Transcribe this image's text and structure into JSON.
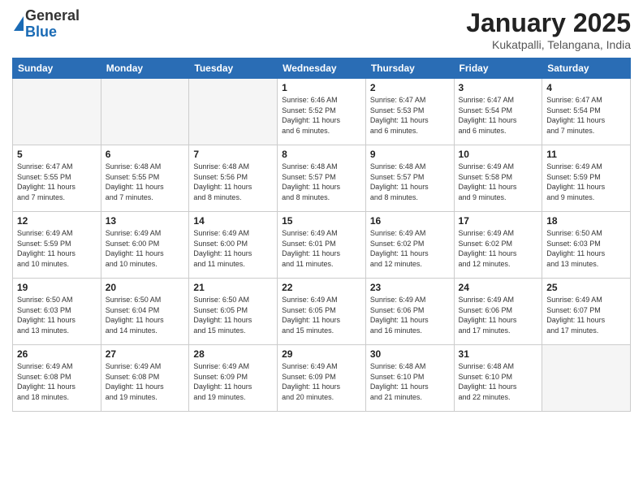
{
  "logo": {
    "line1": "General",
    "line2": "Blue"
  },
  "title": "January 2025",
  "subtitle": "Kukatpalli, Telangana, India",
  "headers": [
    "Sunday",
    "Monday",
    "Tuesday",
    "Wednesday",
    "Thursday",
    "Friday",
    "Saturday"
  ],
  "weeks": [
    [
      {
        "day": "",
        "info": ""
      },
      {
        "day": "",
        "info": ""
      },
      {
        "day": "",
        "info": ""
      },
      {
        "day": "1",
        "info": "Sunrise: 6:46 AM\nSunset: 5:52 PM\nDaylight: 11 hours\nand 6 minutes."
      },
      {
        "day": "2",
        "info": "Sunrise: 6:47 AM\nSunset: 5:53 PM\nDaylight: 11 hours\nand 6 minutes."
      },
      {
        "day": "3",
        "info": "Sunrise: 6:47 AM\nSunset: 5:54 PM\nDaylight: 11 hours\nand 6 minutes."
      },
      {
        "day": "4",
        "info": "Sunrise: 6:47 AM\nSunset: 5:54 PM\nDaylight: 11 hours\nand 7 minutes."
      }
    ],
    [
      {
        "day": "5",
        "info": "Sunrise: 6:47 AM\nSunset: 5:55 PM\nDaylight: 11 hours\nand 7 minutes."
      },
      {
        "day": "6",
        "info": "Sunrise: 6:48 AM\nSunset: 5:55 PM\nDaylight: 11 hours\nand 7 minutes."
      },
      {
        "day": "7",
        "info": "Sunrise: 6:48 AM\nSunset: 5:56 PM\nDaylight: 11 hours\nand 8 minutes."
      },
      {
        "day": "8",
        "info": "Sunrise: 6:48 AM\nSunset: 5:57 PM\nDaylight: 11 hours\nand 8 minutes."
      },
      {
        "day": "9",
        "info": "Sunrise: 6:48 AM\nSunset: 5:57 PM\nDaylight: 11 hours\nand 8 minutes."
      },
      {
        "day": "10",
        "info": "Sunrise: 6:49 AM\nSunset: 5:58 PM\nDaylight: 11 hours\nand 9 minutes."
      },
      {
        "day": "11",
        "info": "Sunrise: 6:49 AM\nSunset: 5:59 PM\nDaylight: 11 hours\nand 9 minutes."
      }
    ],
    [
      {
        "day": "12",
        "info": "Sunrise: 6:49 AM\nSunset: 5:59 PM\nDaylight: 11 hours\nand 10 minutes."
      },
      {
        "day": "13",
        "info": "Sunrise: 6:49 AM\nSunset: 6:00 PM\nDaylight: 11 hours\nand 10 minutes."
      },
      {
        "day": "14",
        "info": "Sunrise: 6:49 AM\nSunset: 6:00 PM\nDaylight: 11 hours\nand 11 minutes."
      },
      {
        "day": "15",
        "info": "Sunrise: 6:49 AM\nSunset: 6:01 PM\nDaylight: 11 hours\nand 11 minutes."
      },
      {
        "day": "16",
        "info": "Sunrise: 6:49 AM\nSunset: 6:02 PM\nDaylight: 11 hours\nand 12 minutes."
      },
      {
        "day": "17",
        "info": "Sunrise: 6:49 AM\nSunset: 6:02 PM\nDaylight: 11 hours\nand 12 minutes."
      },
      {
        "day": "18",
        "info": "Sunrise: 6:50 AM\nSunset: 6:03 PM\nDaylight: 11 hours\nand 13 minutes."
      }
    ],
    [
      {
        "day": "19",
        "info": "Sunrise: 6:50 AM\nSunset: 6:03 PM\nDaylight: 11 hours\nand 13 minutes."
      },
      {
        "day": "20",
        "info": "Sunrise: 6:50 AM\nSunset: 6:04 PM\nDaylight: 11 hours\nand 14 minutes."
      },
      {
        "day": "21",
        "info": "Sunrise: 6:50 AM\nSunset: 6:05 PM\nDaylight: 11 hours\nand 15 minutes."
      },
      {
        "day": "22",
        "info": "Sunrise: 6:49 AM\nSunset: 6:05 PM\nDaylight: 11 hours\nand 15 minutes."
      },
      {
        "day": "23",
        "info": "Sunrise: 6:49 AM\nSunset: 6:06 PM\nDaylight: 11 hours\nand 16 minutes."
      },
      {
        "day": "24",
        "info": "Sunrise: 6:49 AM\nSunset: 6:06 PM\nDaylight: 11 hours\nand 17 minutes."
      },
      {
        "day": "25",
        "info": "Sunrise: 6:49 AM\nSunset: 6:07 PM\nDaylight: 11 hours\nand 17 minutes."
      }
    ],
    [
      {
        "day": "26",
        "info": "Sunrise: 6:49 AM\nSunset: 6:08 PM\nDaylight: 11 hours\nand 18 minutes."
      },
      {
        "day": "27",
        "info": "Sunrise: 6:49 AM\nSunset: 6:08 PM\nDaylight: 11 hours\nand 19 minutes."
      },
      {
        "day": "28",
        "info": "Sunrise: 6:49 AM\nSunset: 6:09 PM\nDaylight: 11 hours\nand 19 minutes."
      },
      {
        "day": "29",
        "info": "Sunrise: 6:49 AM\nSunset: 6:09 PM\nDaylight: 11 hours\nand 20 minutes."
      },
      {
        "day": "30",
        "info": "Sunrise: 6:48 AM\nSunset: 6:10 PM\nDaylight: 11 hours\nand 21 minutes."
      },
      {
        "day": "31",
        "info": "Sunrise: 6:48 AM\nSunset: 6:10 PM\nDaylight: 11 hours\nand 22 minutes."
      },
      {
        "day": "",
        "info": ""
      }
    ]
  ]
}
